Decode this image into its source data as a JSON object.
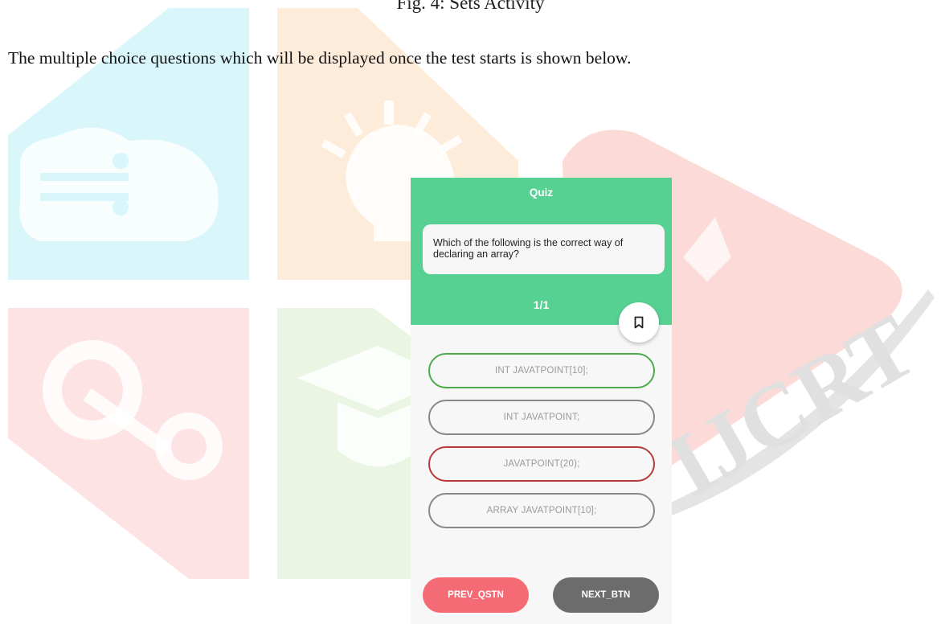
{
  "caption_top": "Fig. 4: Sets Activity",
  "paragraph": "The multiple choice questions which will be displayed once the test starts is shown below.",
  "watermark": {
    "text": "IJCRT"
  },
  "quiz": {
    "title": "Quiz",
    "question": "Which of the following is the correct way of declaring an array?",
    "counter": "1/1",
    "bookmark_icon": "bookmark-icon",
    "options": [
      {
        "label": "INT JAVATPOINT[10];",
        "state": "correct",
        "border_color": "#4caa4c"
      },
      {
        "label": "INT JAVATPOINT;",
        "state": "default",
        "border_color": "#888888"
      },
      {
        "label": "JAVATPOINT(20);",
        "state": "wrong",
        "border_color": "#b83a3a"
      },
      {
        "label": "ARRAY JAVATPOINT[10];",
        "state": "default",
        "border_color": "#888888"
      }
    ],
    "prev_button": "PREV_QSTN",
    "next_button": "NEXT_BTN",
    "colors": {
      "header": "#57d192",
      "prev": "#f56b75",
      "next": "#6c6c6c"
    }
  }
}
